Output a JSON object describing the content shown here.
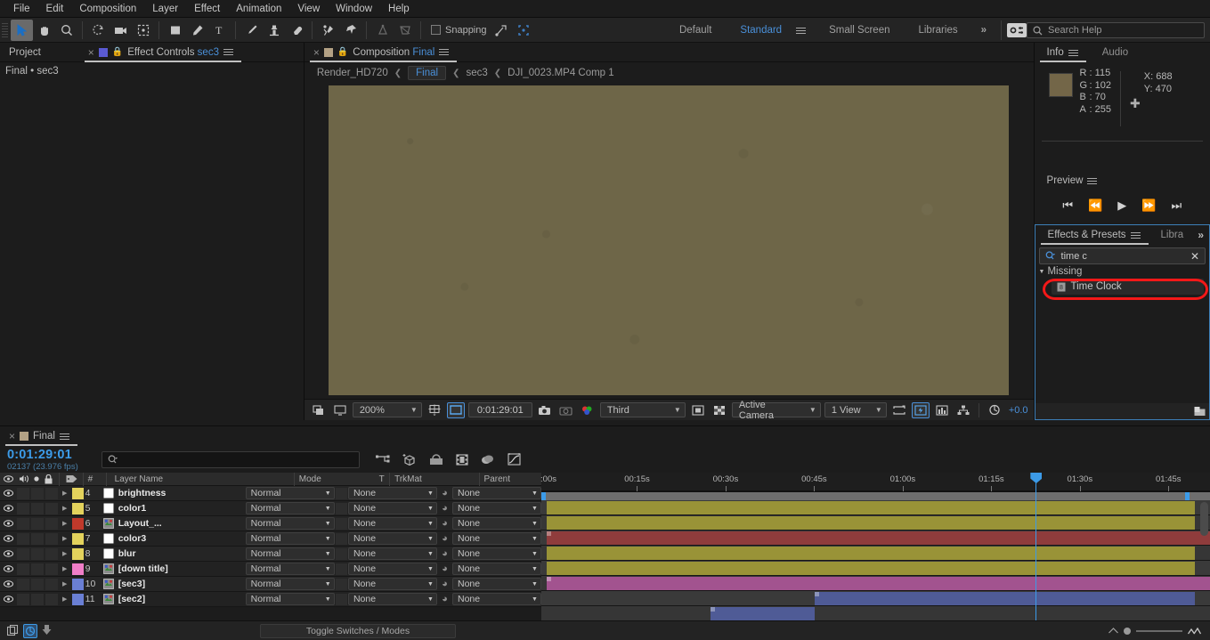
{
  "menubar": {
    "items": [
      "File",
      "Edit",
      "Composition",
      "Layer",
      "Effect",
      "Animation",
      "View",
      "Window",
      "Help"
    ]
  },
  "toolbar": {
    "snapping_label": "Snapping",
    "workspaces": [
      "Default",
      "Standard",
      "Small Screen",
      "Libraries"
    ],
    "active_workspace": "Standard",
    "overflow_label": "»",
    "search_help_placeholder": "Search Help",
    "search_help_value": "Search Help"
  },
  "left_panel": {
    "tabs": [
      {
        "label": "Project",
        "closable": false,
        "active": false
      },
      {
        "label": "Effect Controls ",
        "highlight": "sec3",
        "closable": true,
        "active": true
      }
    ],
    "subtitle": "Final • sec3"
  },
  "composition_panel": {
    "tab_label": "Composition ",
    "tab_highlight": "Final",
    "breadcrumb": [
      {
        "label": "Render_HD720",
        "current": false
      },
      {
        "label": "Final",
        "current": true
      },
      {
        "label": "sec3",
        "current": false
      },
      {
        "label": "DJI_0023.MP4 Comp 1",
        "current": false
      }
    ],
    "viewer_bar": {
      "zoom": "200%",
      "timecode": "0:01:29:01",
      "resolution": "Third",
      "camera": "Active Camera",
      "views": "1 View",
      "exposure": "+0.0"
    }
  },
  "info_panel": {
    "tabs": [
      "Info",
      "Audio"
    ],
    "active_tab": "Info",
    "swatch_color": "#736648",
    "channels": [
      {
        "key": "R",
        "value": "115"
      },
      {
        "key": "G",
        "value": "102"
      },
      {
        "key": "B",
        "value": "70"
      },
      {
        "key": "A",
        "value": "255"
      }
    ],
    "coords": [
      {
        "key": "X",
        "value": "688"
      },
      {
        "key": "Y",
        "value": "470"
      }
    ]
  },
  "preview_panel": {
    "title": "Preview",
    "buttons": [
      "first-frame-icon",
      "previous-frame-icon",
      "play-icon",
      "next-frame-icon",
      "last-frame-icon"
    ]
  },
  "effects_panel": {
    "tabs": [
      "Effects & Presets",
      "Libra"
    ],
    "active_tab": "Effects & Presets",
    "overflow_label": "»",
    "search_value": "time c",
    "search_placeholder": "",
    "clear_label": "✕",
    "groups": [
      {
        "name": "Missing",
        "expanded": true,
        "items": [
          {
            "label": "Time Clock",
            "highlighted": true
          }
        ]
      }
    ],
    "highlight_color": "#f41818"
  },
  "timeline": {
    "tab_label": "Final",
    "current_time": "0:01:29:01",
    "frame_info": "02137 (23.976 fps)",
    "search_placeholder": "",
    "columns": [
      "#",
      "Layer Name",
      "Mode",
      "T",
      "TrkMat",
      "Parent"
    ],
    "toggle_switches_label": "Toggle Switches / Modes",
    "ruler_labels": [
      ":00s",
      "00:15s",
      "00:30s",
      "00:45s",
      "01:00s",
      "01:15s",
      "01:30s",
      "01:45s"
    ],
    "layers": [
      {
        "num": "4",
        "name": "brightness",
        "color": "#e3d25c",
        "mode": "Normal",
        "trkmat": "None",
        "parent": "None",
        "source_icon": "solid-icon",
        "bar_color": "#999337",
        "bar_start": 0,
        "bar_end": 100
      },
      {
        "num": "5",
        "name": "color1",
        "color": "#e3d25c",
        "mode": "Normal",
        "trkmat": "None",
        "parent": "None",
        "source_icon": "solid-icon",
        "bar_color": "#999337",
        "bar_start": 0,
        "bar_end": 100
      },
      {
        "num": "6",
        "name": "Layout_...",
        "color": "#c0392b",
        "mode": "Normal",
        "trkmat": "None",
        "parent": "None",
        "source_icon": "comp-icon",
        "bar_color": "#8f3c3c",
        "bar_start": 0,
        "bar_end": 103
      },
      {
        "num": "7",
        "name": "color3",
        "color": "#e3d25c",
        "mode": "Normal",
        "trkmat": "None",
        "parent": "None",
        "source_icon": "solid-icon",
        "bar_color": "#999337",
        "bar_start": 0,
        "bar_end": 100
      },
      {
        "num": "8",
        "name": "blur",
        "color": "#e3d25c",
        "mode": "Normal",
        "trkmat": "None",
        "parent": "None",
        "source_icon": "solid-icon",
        "bar_color": "#999337",
        "bar_start": 0,
        "bar_end": 100
      },
      {
        "num": "9",
        "name": "[down title]",
        "color": "#f07ec8",
        "mode": "Normal",
        "trkmat": "None",
        "parent": "None",
        "source_icon": "comp-icon",
        "bar_color": "#a2538f",
        "bar_start": 0,
        "bar_end": 103
      },
      {
        "num": "10",
        "name": "[sec3]",
        "color": "#6a7fd4",
        "mode": "Normal",
        "trkmat": "None",
        "parent": "None",
        "source_icon": "comp-icon",
        "bar_color": "#4f5b96",
        "bar_start": 41.3,
        "bar_end": 100
      },
      {
        "num": "11",
        "name": "[sec2]",
        "color": "#6a7fd4",
        "mode": "Normal",
        "trkmat": "None",
        "parent": "None",
        "source_icon": "comp-icon",
        "bar_color": "#4f5b96",
        "bar_start": 25.3,
        "bar_end": 41.3
      }
    ]
  },
  "colors": {
    "accent_blue": "#3c9be8",
    "panel_bg": "#1c1c1c",
    "viewer_bg": "#6e6648"
  }
}
